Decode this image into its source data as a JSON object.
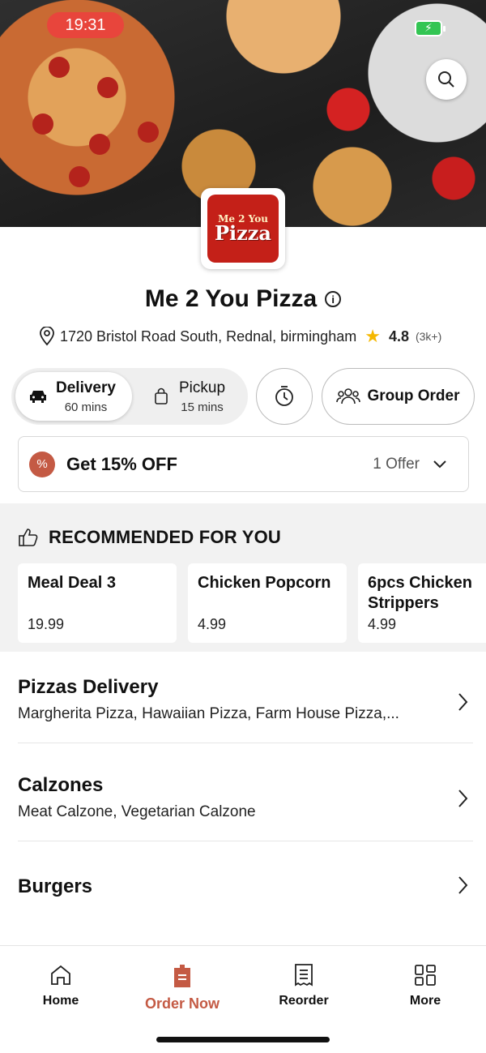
{
  "status_bar": {
    "time": "19:31"
  },
  "restaurant": {
    "name": "Me 2 You Pizza",
    "logo_top": "Me 2 You",
    "logo_bottom": "Pizza",
    "address": "1720 Bristol Road South, Rednal, birmingham",
    "rating": "4.8",
    "rating_count": "(3k+)"
  },
  "order_mode": {
    "delivery": {
      "label": "Delivery",
      "time": "60 mins",
      "selected": true
    },
    "pickup": {
      "label": "Pickup",
      "time": "15 mins",
      "selected": false
    }
  },
  "group_order_label": "Group Order",
  "offer": {
    "title": "Get 15% OFF",
    "count": "1 Offer",
    "badge": "%"
  },
  "recommended": {
    "heading": "RECOMMENDED FOR YOU",
    "items": [
      {
        "name": "Meal Deal 3",
        "price": "19.99"
      },
      {
        "name": "Chicken Popcorn",
        "price": "4.99"
      },
      {
        "name": "6pcs Chicken Strippers",
        "price": "4.99"
      }
    ]
  },
  "categories": [
    {
      "title": "Pizzas Delivery",
      "subtitle": "Margherita Pizza, Hawaiian Pizza, Farm House Pizza,..."
    },
    {
      "title": "Calzones",
      "subtitle": "Meat Calzone, Vegetarian Calzone"
    },
    {
      "title": "Burgers",
      "subtitle": ""
    }
  ],
  "bottom_nav": [
    {
      "label": "Home",
      "icon": "home-icon"
    },
    {
      "label": "Order Now",
      "icon": "order-bag-icon",
      "active": true
    },
    {
      "label": "Reorder",
      "icon": "receipt-icon"
    },
    {
      "label": "More",
      "icon": "grid-icon"
    }
  ],
  "colors": {
    "accent": "#c45a44",
    "status_pill": "#e8453c",
    "logo_red": "#c42018",
    "star": "#f5b800"
  }
}
